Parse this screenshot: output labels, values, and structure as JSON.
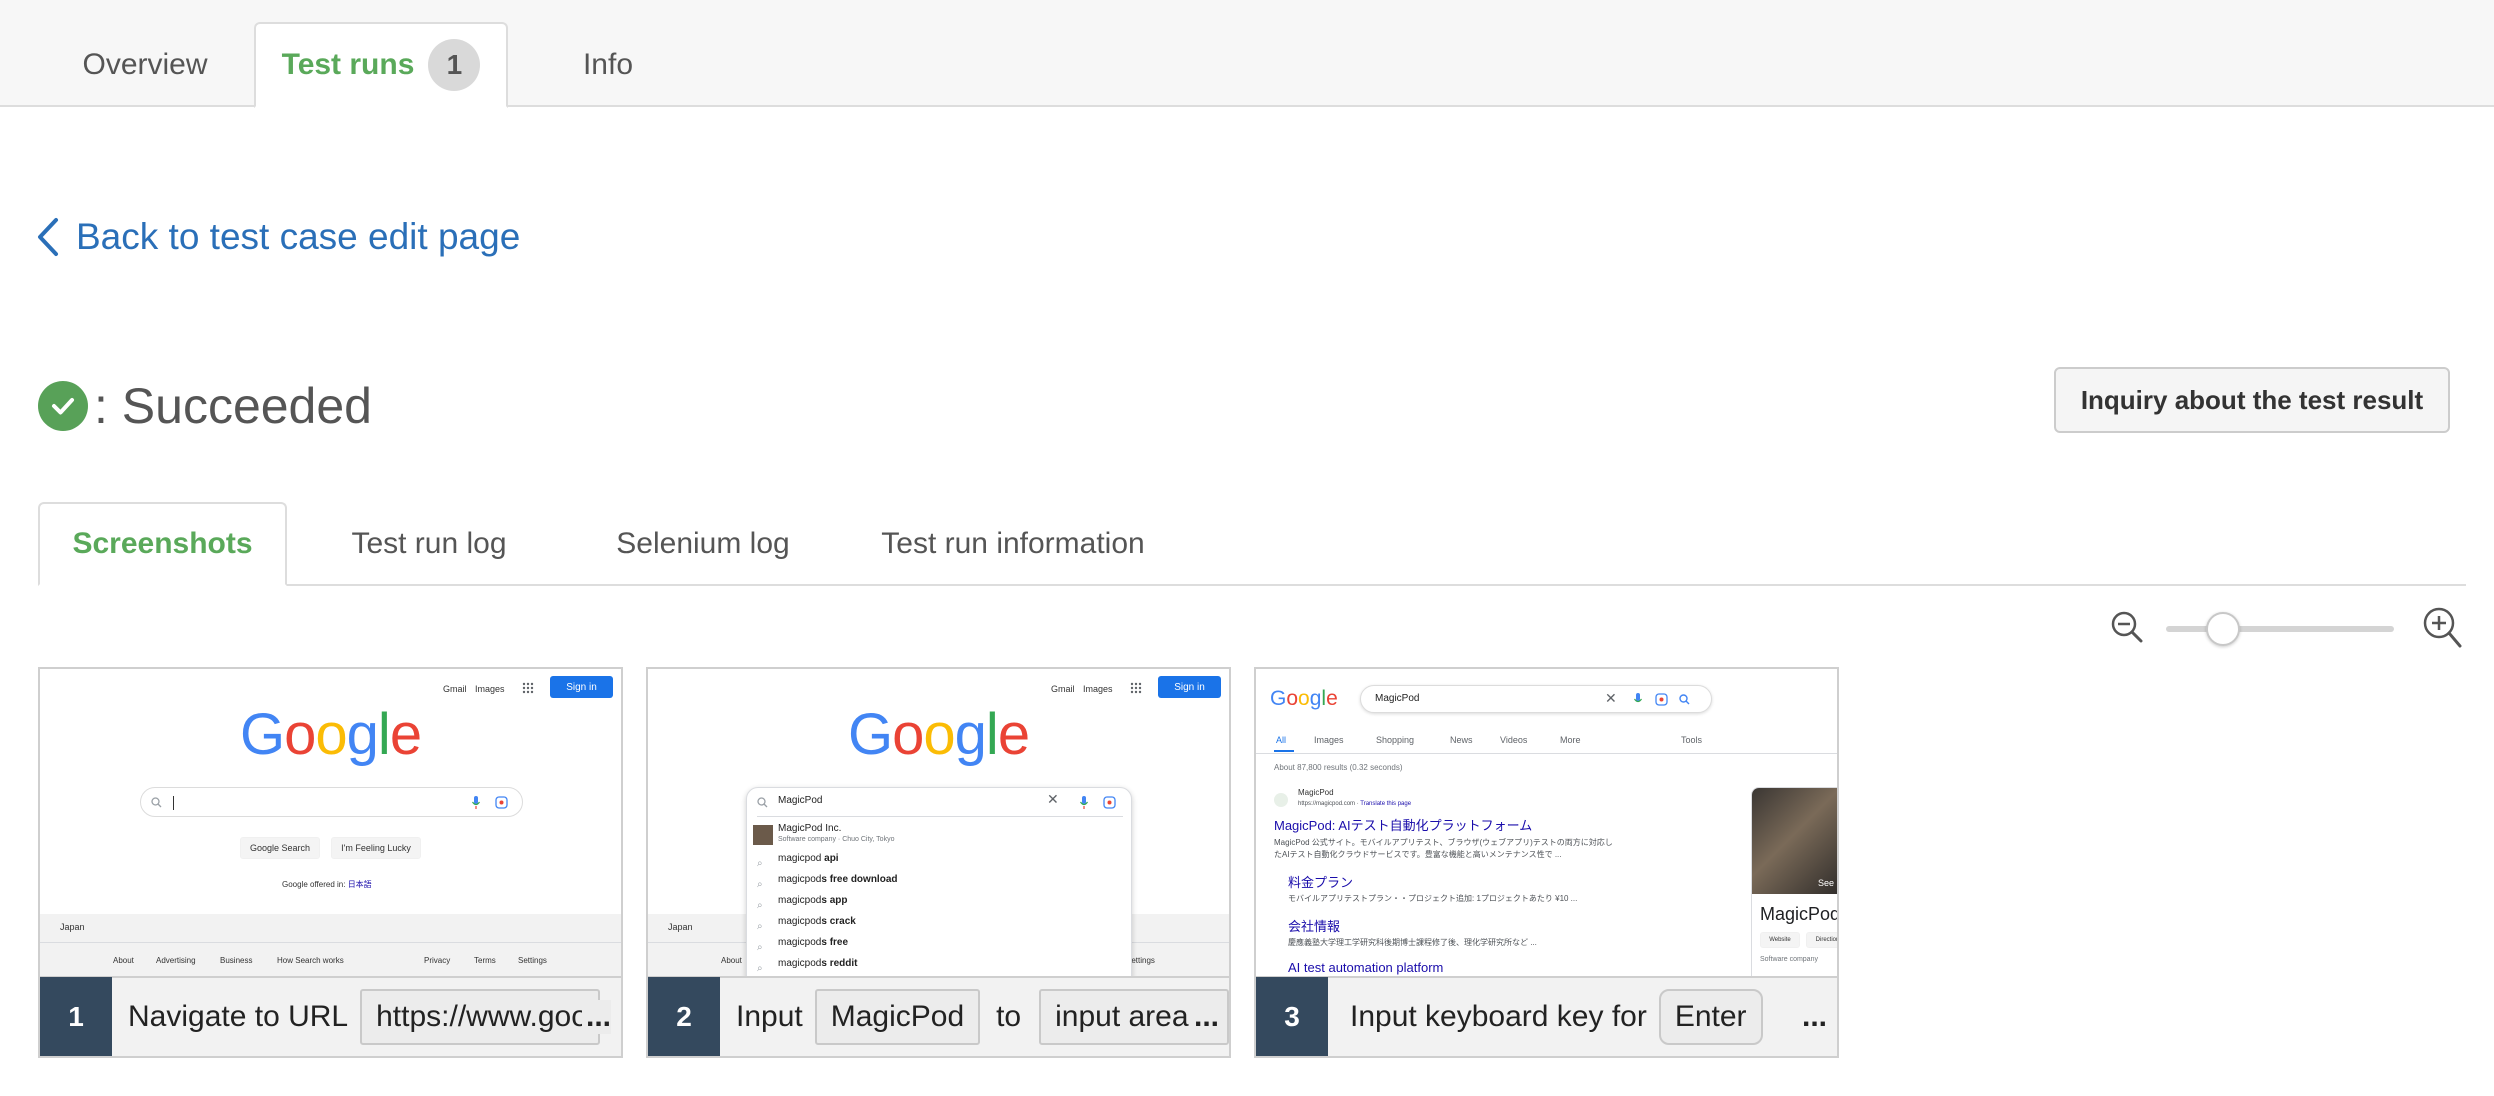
{
  "top_tabs": {
    "overview": "Overview",
    "test_runs": "Test runs",
    "test_runs_count": "1",
    "info": "Info"
  },
  "back_link": "Back to test case edit page",
  "status": {
    "text": ": Succeeded",
    "color": "#58a158"
  },
  "inquiry_button": "Inquiry about the test result",
  "content_tabs": {
    "screenshots": "Screenshots",
    "test_run_log": "Test run log",
    "selenium_log": "Selenium log",
    "test_run_information": "Test run information"
  },
  "zoom": {
    "level": 0.25
  },
  "cards": [
    {
      "number": "1",
      "text1": "Navigate to URL",
      "param1": "https://www.google.co.jp/",
      "ellipsis": "...",
      "thumb": {
        "gmail": "Gmail",
        "images": "Images",
        "signin": "Sign in",
        "logo": "Google",
        "search_btn": "Google Search",
        "lucky_btn": "I'm Feeling Lucky",
        "offered": "Google offered in:",
        "offered_lang": "日本語",
        "country": "Japan",
        "footer_links": [
          "About",
          "Advertising",
          "Business",
          "How Search works",
          "Privacy",
          "Terms",
          "Settings"
        ]
      }
    },
    {
      "number": "2",
      "text1": "Input",
      "param1": "MagicPod",
      "text2": "to",
      "param2": "input area",
      "ellipsis": "...",
      "thumb": {
        "gmail": "Gmail",
        "images": "Images",
        "signin": "Sign in",
        "logo": "Google",
        "query": "MagicPod",
        "company": "MagicPod Inc.",
        "company_sub": "Software company · Chuo City, Tokyo",
        "suggestions": [
          {
            "pre": "magicpod ",
            "bold": "api"
          },
          {
            "pre": "magicpod",
            "bold": "s free download"
          },
          {
            "pre": "magicpod",
            "bold": "s app"
          },
          {
            "pre": "magicpod",
            "bold": "s crack"
          },
          {
            "pre": "magicpod",
            "bold": "s free"
          },
          {
            "pre": "magicpod",
            "bold": "s reddit"
          }
        ],
        "country": "Japan",
        "footer_about": "About",
        "footer_settings": "Settings"
      }
    },
    {
      "number": "3",
      "text1": "Input keyboard key for",
      "param1": "Enter",
      "ellipsis": "...",
      "thumb": {
        "logo": "Google",
        "query": "MagicPod",
        "tabs": [
          "All",
          "Images",
          "Shopping",
          "News",
          "Videos",
          "More"
        ],
        "tools": "Tools",
        "stats": "About 87,800 results (0.32 seconds)",
        "site_name": "MagicPod",
        "site_url": "https://magicpod.com",
        "translate": "Translate this page",
        "result1_title": "MagicPod: AIテスト自動化プラットフォーム",
        "result1_desc1": "MagicPod 公式サイト。モバイルアプリテスト、ブラウザ(ウェブアプリ)テストの両方に対応し",
        "result1_desc2": "たAIテスト自動化クラウドサービスです。豊富な機能と高いメンテナンス性で ...",
        "sub1_title": "料金プラン",
        "sub1_desc": "モバイルアプリテストプラン・・プロジェクト追加: 1プロジェクトあたり ¥10 ...",
        "sub2_title": "会社情報",
        "sub2_desc": "慶應義塾大学理工学研究科後期博士課程修了後、理化学研究所など ...",
        "sub3_title": "AI test automation platform",
        "panel_name": "MagicPod",
        "panel_website": "Website",
        "panel_directions": "Directions",
        "panel_type": "Software company",
        "panel_see": "See"
      }
    }
  ]
}
